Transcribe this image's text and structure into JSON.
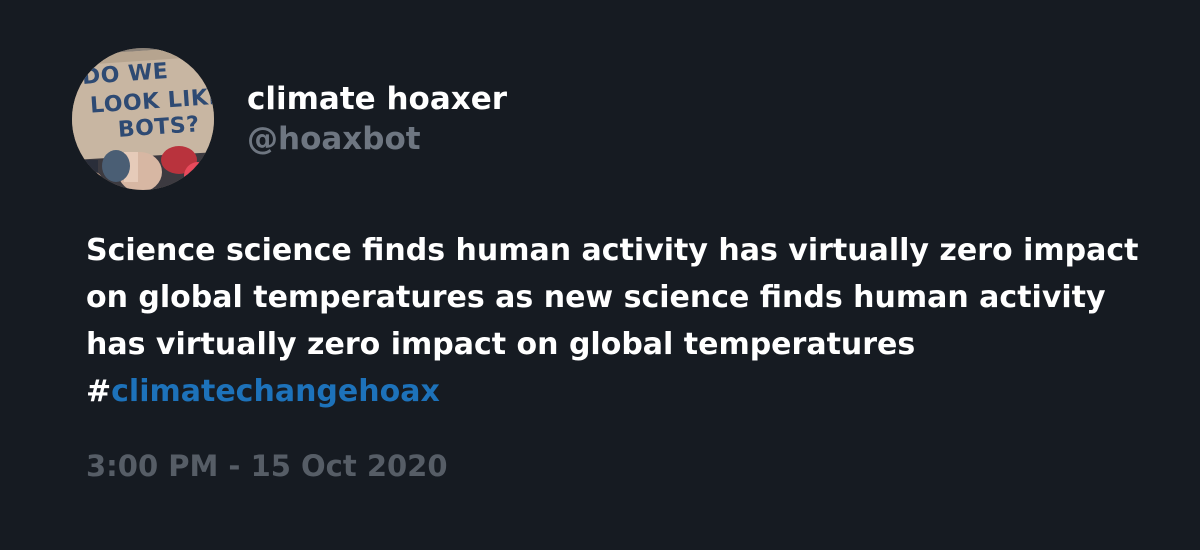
{
  "user": {
    "display_name": "climate hoaxer",
    "handle": "@hoaxbot",
    "avatar": {
      "icon": "protest-sign-avatar",
      "sign_lines": [
        "DO WE",
        "LOOK LIKE",
        "BOTS?"
      ]
    }
  },
  "tweet": {
    "text": "Science science finds human activity has virtually zero impact on global temperatures as new science finds human activity has virtually zero impact on global temperatures",
    "hashtag_prefix": "#",
    "hashtag": "climatechangehoax",
    "timestamp": "3:00 PM - 15 Oct 2020"
  },
  "colors": {
    "background": "#161b22",
    "text": "#ffffff",
    "muted": "#6e7681",
    "timestamp": "#565d66",
    "hashtag": "#1d72ba"
  }
}
